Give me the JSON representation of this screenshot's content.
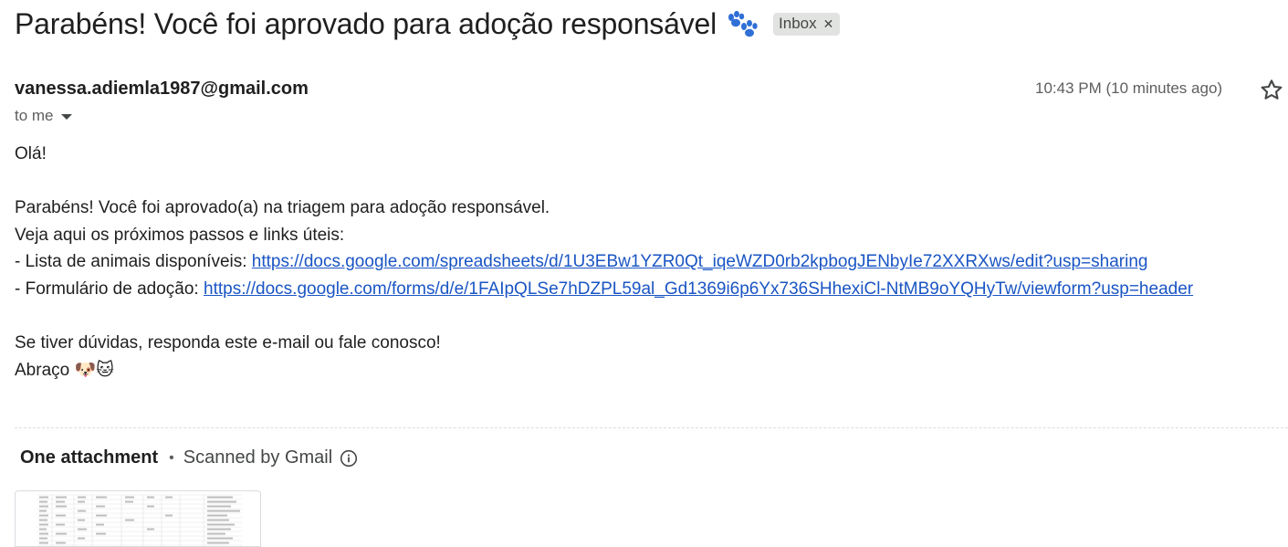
{
  "email": {
    "subject": "Parabéns! Você foi aprovado para adoção responsável",
    "label_chip": "Inbox",
    "sender": "vanessa.adiemla1987@gmail.com",
    "recipient_summary": "to me",
    "timestamp": "10:43 PM (10 minutes ago)"
  },
  "body": {
    "greeting": "Olá!",
    "line1": "Parabéns! Você foi aprovado(a) na triagem para adoção responsável.",
    "line2": "Veja aqui os próximos passos e links úteis:",
    "link1_prefix": "- Lista de animais disponíveis: ",
    "link1_url": "https://docs.google.com/spreadsheets/d/1U3EBw1YZR0Qt_iqeWZD0rb2kpbogJENbyIe72XXRXws/edit?usp=sharing",
    "link2_prefix": "- Formulário de adoção: ",
    "link2_url": "https://docs.google.com/forms/d/e/1FAIpQLSe7hDZPL59al_Gd1369i6p6Yx736SHhexiCl-NtMB9oYQHyTw/viewform?usp=header",
    "closing1": "Se tiver dúvidas, responda este e-mail ou fale conosco!",
    "closing2": "Abraço ",
    "closing_emojis": "🐶🐱"
  },
  "attachments": {
    "title": "One attachment",
    "separator": "•",
    "scan_note": "Scanned by Gmail"
  },
  "colors": {
    "link": "#1a55c4",
    "paw": "#2f6fd6",
    "chip_bg": "#e1e3e1"
  },
  "icons": {
    "subject_icon": "paw-prints-icon",
    "chip_close": "close-icon",
    "star": "star-icon",
    "caret": "caret-down-icon",
    "info": "info-icon"
  }
}
